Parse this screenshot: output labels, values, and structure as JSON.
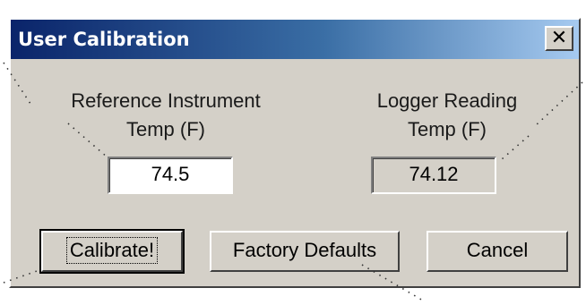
{
  "dialog": {
    "title": "User Calibration",
    "close_glyph": "✕",
    "close_icon": "close-icon"
  },
  "reference": {
    "label_line1": "Reference Instrument",
    "label_line2": "Temp (F)",
    "value": "74.5"
  },
  "logger": {
    "label_line1": "Logger Reading",
    "label_line2": "Temp (F)",
    "value": "74.12"
  },
  "buttons": {
    "calibrate": "Calibrate!",
    "factory_defaults": "Factory Defaults",
    "cancel": "Cancel"
  },
  "colors": {
    "dialog_face": "#d4d0c8",
    "title_gradient_start": "#0a246a",
    "title_gradient_end": "#a6caf0",
    "title_text": "#ffffff"
  }
}
